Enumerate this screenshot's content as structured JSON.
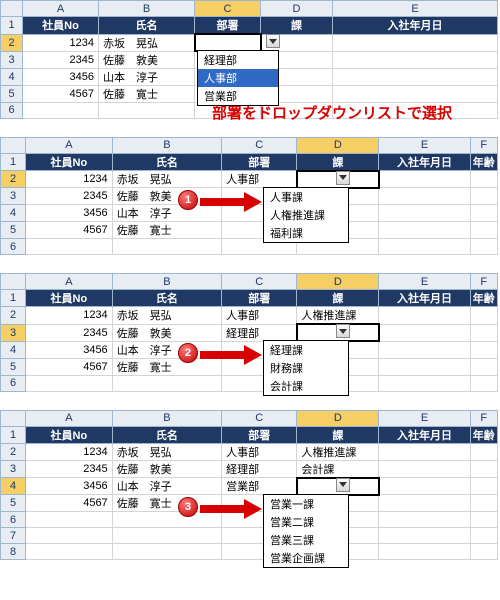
{
  "col_letters": [
    "A",
    "B",
    "C",
    "D",
    "E",
    "F"
  ],
  "headers": {
    "a": "社員No",
    "b": "氏名",
    "c": "部署",
    "d": "課",
    "e": "入社年月日",
    "f": "年齢"
  },
  "employees": [
    {
      "no": "1234",
      "name": "赤坂　晃弘"
    },
    {
      "no": "2345",
      "name": "佐藤　敦美"
    },
    {
      "no": "3456",
      "name": "山本　淳子"
    },
    {
      "no": "4567",
      "name": "佐藤　寛士"
    }
  ],
  "panel1": {
    "dropdown": [
      "経理部",
      "人事部",
      "営業部"
    ],
    "hl_index": 1,
    "annotation": "部署をドロップダウンリストで選択"
  },
  "panel2": {
    "badge": "1",
    "dept_row1": "人事部",
    "dropdown": [
      "人事課",
      "人権推進課",
      "福利課"
    ]
  },
  "panel3": {
    "badge": "2",
    "depts": [
      "人事部",
      "経理部"
    ],
    "ka_row1": "人権推進課",
    "dropdown": [
      "経理課",
      "財務課",
      "会計課"
    ]
  },
  "panel4": {
    "badge": "3",
    "depts": [
      "人事部",
      "経理部",
      "営業部"
    ],
    "kas": [
      "人権推進課",
      "会計課"
    ],
    "dropdown": [
      "営業一課",
      "営業二課",
      "営業三課",
      "営業企画課"
    ]
  }
}
